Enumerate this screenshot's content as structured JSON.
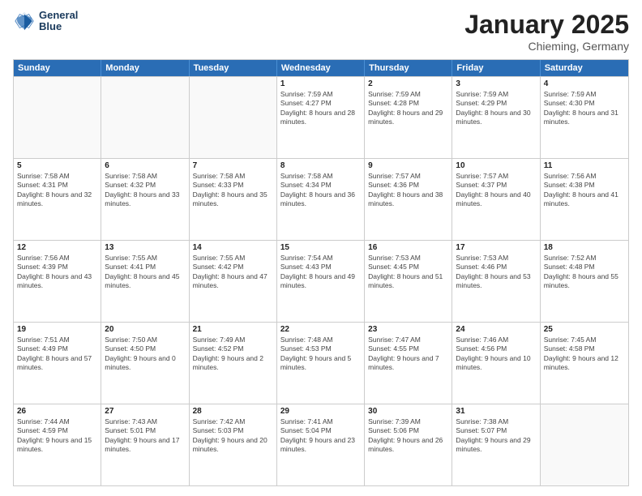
{
  "header": {
    "logo": {
      "line1": "General",
      "line2": "Blue"
    },
    "title": "January 2025",
    "subtitle": "Chieming, Germany"
  },
  "calendar": {
    "days_of_week": [
      "Sunday",
      "Monday",
      "Tuesday",
      "Wednesday",
      "Thursday",
      "Friday",
      "Saturday"
    ],
    "weeks": [
      [
        {
          "day": "",
          "empty": true
        },
        {
          "day": "",
          "empty": true
        },
        {
          "day": "",
          "empty": true
        },
        {
          "day": "1",
          "sunrise": "7:59 AM",
          "sunset": "4:27 PM",
          "daylight": "8 hours and 28 minutes."
        },
        {
          "day": "2",
          "sunrise": "7:59 AM",
          "sunset": "4:28 PM",
          "daylight": "8 hours and 29 minutes."
        },
        {
          "day": "3",
          "sunrise": "7:59 AM",
          "sunset": "4:29 PM",
          "daylight": "8 hours and 30 minutes."
        },
        {
          "day": "4",
          "sunrise": "7:59 AM",
          "sunset": "4:30 PM",
          "daylight": "8 hours and 31 minutes."
        }
      ],
      [
        {
          "day": "5",
          "sunrise": "7:58 AM",
          "sunset": "4:31 PM",
          "daylight": "8 hours and 32 minutes."
        },
        {
          "day": "6",
          "sunrise": "7:58 AM",
          "sunset": "4:32 PM",
          "daylight": "8 hours and 33 minutes."
        },
        {
          "day": "7",
          "sunrise": "7:58 AM",
          "sunset": "4:33 PM",
          "daylight": "8 hours and 35 minutes."
        },
        {
          "day": "8",
          "sunrise": "7:58 AM",
          "sunset": "4:34 PM",
          "daylight": "8 hours and 36 minutes."
        },
        {
          "day": "9",
          "sunrise": "7:57 AM",
          "sunset": "4:36 PM",
          "daylight": "8 hours and 38 minutes."
        },
        {
          "day": "10",
          "sunrise": "7:57 AM",
          "sunset": "4:37 PM",
          "daylight": "8 hours and 40 minutes."
        },
        {
          "day": "11",
          "sunrise": "7:56 AM",
          "sunset": "4:38 PM",
          "daylight": "8 hours and 41 minutes."
        }
      ],
      [
        {
          "day": "12",
          "sunrise": "7:56 AM",
          "sunset": "4:39 PM",
          "daylight": "8 hours and 43 minutes."
        },
        {
          "day": "13",
          "sunrise": "7:55 AM",
          "sunset": "4:41 PM",
          "daylight": "8 hours and 45 minutes."
        },
        {
          "day": "14",
          "sunrise": "7:55 AM",
          "sunset": "4:42 PM",
          "daylight": "8 hours and 47 minutes."
        },
        {
          "day": "15",
          "sunrise": "7:54 AM",
          "sunset": "4:43 PM",
          "daylight": "8 hours and 49 minutes."
        },
        {
          "day": "16",
          "sunrise": "7:53 AM",
          "sunset": "4:45 PM",
          "daylight": "8 hours and 51 minutes."
        },
        {
          "day": "17",
          "sunrise": "7:53 AM",
          "sunset": "4:46 PM",
          "daylight": "8 hours and 53 minutes."
        },
        {
          "day": "18",
          "sunrise": "7:52 AM",
          "sunset": "4:48 PM",
          "daylight": "8 hours and 55 minutes."
        }
      ],
      [
        {
          "day": "19",
          "sunrise": "7:51 AM",
          "sunset": "4:49 PM",
          "daylight": "8 hours and 57 minutes."
        },
        {
          "day": "20",
          "sunrise": "7:50 AM",
          "sunset": "4:50 PM",
          "daylight": "9 hours and 0 minutes."
        },
        {
          "day": "21",
          "sunrise": "7:49 AM",
          "sunset": "4:52 PM",
          "daylight": "9 hours and 2 minutes."
        },
        {
          "day": "22",
          "sunrise": "7:48 AM",
          "sunset": "4:53 PM",
          "daylight": "9 hours and 5 minutes."
        },
        {
          "day": "23",
          "sunrise": "7:47 AM",
          "sunset": "4:55 PM",
          "daylight": "9 hours and 7 minutes."
        },
        {
          "day": "24",
          "sunrise": "7:46 AM",
          "sunset": "4:56 PM",
          "daylight": "9 hours and 10 minutes."
        },
        {
          "day": "25",
          "sunrise": "7:45 AM",
          "sunset": "4:58 PM",
          "daylight": "9 hours and 12 minutes."
        }
      ],
      [
        {
          "day": "26",
          "sunrise": "7:44 AM",
          "sunset": "4:59 PM",
          "daylight": "9 hours and 15 minutes."
        },
        {
          "day": "27",
          "sunrise": "7:43 AM",
          "sunset": "5:01 PM",
          "daylight": "9 hours and 17 minutes."
        },
        {
          "day": "28",
          "sunrise": "7:42 AM",
          "sunset": "5:03 PM",
          "daylight": "9 hours and 20 minutes."
        },
        {
          "day": "29",
          "sunrise": "7:41 AM",
          "sunset": "5:04 PM",
          "daylight": "9 hours and 23 minutes."
        },
        {
          "day": "30",
          "sunrise": "7:39 AM",
          "sunset": "5:06 PM",
          "daylight": "9 hours and 26 minutes."
        },
        {
          "day": "31",
          "sunrise": "7:38 AM",
          "sunset": "5:07 PM",
          "daylight": "9 hours and 29 minutes."
        },
        {
          "day": "",
          "empty": true
        }
      ]
    ]
  }
}
